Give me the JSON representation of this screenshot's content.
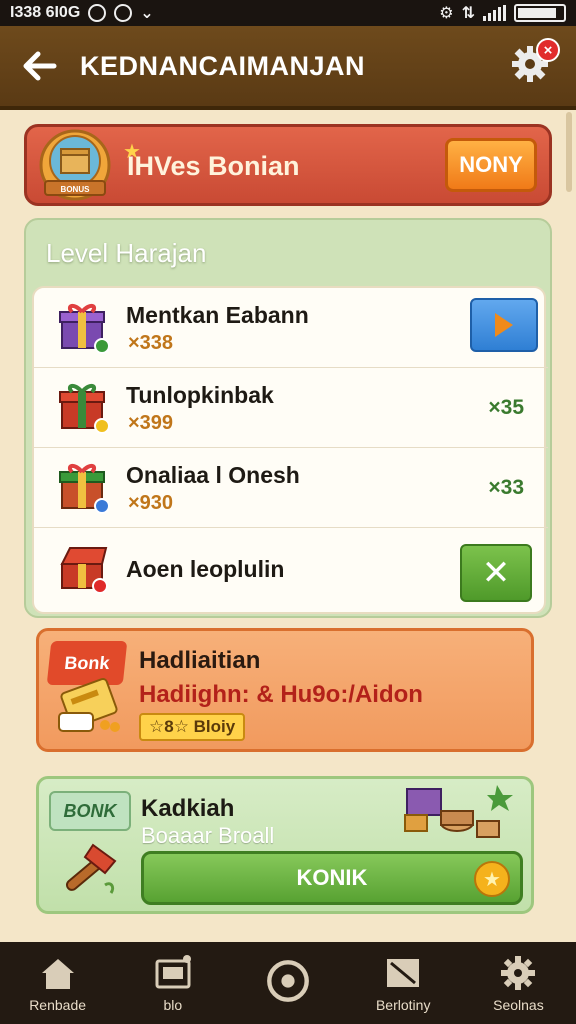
{
  "status_bar": {
    "left_text": "I338 6I0G",
    "icons": [
      "location-icon",
      "vpn-icon",
      "notification-icon",
      "settings-icon",
      "signal-icon",
      "battery-icon"
    ]
  },
  "header": {
    "title": "KEDNANCAIMANJAN",
    "back_icon": "back-arrow-icon",
    "settings_icon": "gear-icon",
    "badge_count": "×"
  },
  "bonus_banner": {
    "title": "IHVes Bonian",
    "star": "★",
    "button_label": "NONY",
    "badge_text": "BONUS"
  },
  "level": {
    "title": "Level Harajan",
    "items": [
      {
        "name": "Mentkan Eabann",
        "qty": "×338",
        "count": "",
        "action": "play"
      },
      {
        "name": "Tunlopkinbak",
        "qty": "×399",
        "count": "×35",
        "action": ""
      },
      {
        "name": "Onaliaa l Onesh",
        "qty": "×930",
        "count": "×33",
        "action": ""
      },
      {
        "name": "Aoen leoplulin",
        "qty": "",
        "count": "",
        "action": "close"
      }
    ]
  },
  "orange_card": {
    "tag": "Bonk",
    "title": "Hadliaitian",
    "subtitle": "Hadiighn: & Hu9o:/Aidon",
    "pill": "☆8☆ Bloiy"
  },
  "green_card": {
    "tag": "BONK",
    "title": "Kadkiah",
    "subtitle": "Boaaar Broall",
    "button_label": "KONIK",
    "coin": "★"
  },
  "bottom_nav": [
    {
      "label": "Renbade",
      "icon": "home-icon"
    },
    {
      "label": "blo",
      "icon": "ticket-icon"
    },
    {
      "label": "",
      "icon": "circle-icon"
    },
    {
      "label": "Berlotiny",
      "icon": "book-icon"
    },
    {
      "label": "Seolnas",
      "icon": "gear-icon"
    }
  ],
  "colors": {
    "header": "#5a3a14",
    "banner": "#d35540",
    "accent_orange": "#f07a18",
    "accent_green": "#58a232",
    "play_blue": "#2f7fd4",
    "nav_bg": "#231a12"
  }
}
